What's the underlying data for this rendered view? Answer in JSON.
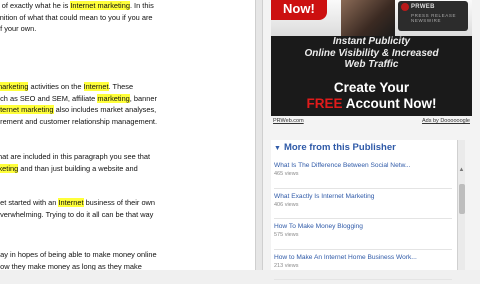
{
  "article": {
    "paragraphs": [
      [
        [
          {
            "t": "s of exactly what he is "
          },
          {
            "t": "Internet marketing",
            "h": true
          },
          {
            "t": ". In this"
          }
        ],
        [
          {
            "t": "finition of what that could mean to you if you are"
          }
        ],
        [
          {
            "t": "of your own."
          }
        ]
      ],
      [
        [
          {
            "t": "marketing",
            "h": true
          },
          {
            "t": " activities on the "
          },
          {
            "t": "Internet",
            "h": true
          },
          {
            "t": ". These"
          }
        ],
        [
          {
            "t": "uch as SEO and SEM, affiliate "
          },
          {
            "t": "marketing",
            "h": true
          },
          {
            "t": ", banner"
          }
        ],
        [
          {
            "t": "nternet marketing",
            "h": true
          },
          {
            "t": " also includes market analyses,"
          }
        ],
        [
          {
            "t": "urement and customer relationship management."
          }
        ]
      ],
      [
        [
          {
            "t": "that are included in this paragraph you see that"
          }
        ],
        [
          {
            "t": "rketing",
            "h": true
          },
          {
            "t": " and than just building a website and"
          }
        ]
      ],
      [
        [
          {
            "t": "get started with an "
          },
          {
            "t": "Internet",
            "h": true
          },
          {
            "t": " business of their own"
          }
        ],
        [
          {
            "t": "overwhelming. Trying to do it all can be that way"
          }
        ]
      ],
      [
        [
          {
            "t": "day in hopes of being able to make money online"
          }
        ],
        [
          {
            "t": "how they make money as long as they make"
          }
        ]
      ]
    ]
  },
  "ad": {
    "badge": "Now!",
    "logo_name": "PRWEB",
    "logo_sub": "PRESS RELEASE NEWSWIRE",
    "headline": [
      "Instant Publicity",
      "Online Visibility & Increased",
      "Web Traffic"
    ],
    "cta_line1": "Create Your",
    "cta_free": "FREE",
    "cta_rest": "Account Now!",
    "source_link": "PRWeb.com",
    "ads_by": "Ads by Doooooogle"
  },
  "publisher": {
    "title": "More from this Publisher",
    "items": [
      {
        "title": "What Is The Difference Between Social Netw...",
        "views": "465 views"
      },
      {
        "title": "What Exactly Is Internet Marketing",
        "views": "406 views"
      },
      {
        "title": "How To Make Money Blogging",
        "views": "575 views"
      },
      {
        "title": "How to Make An Internet Home Business Work...",
        "views": "213 views"
      }
    ]
  },
  "colors": {
    "highlight": "#ffff3a",
    "link": "#2f5aa8",
    "ad_red": "#cc1010"
  }
}
